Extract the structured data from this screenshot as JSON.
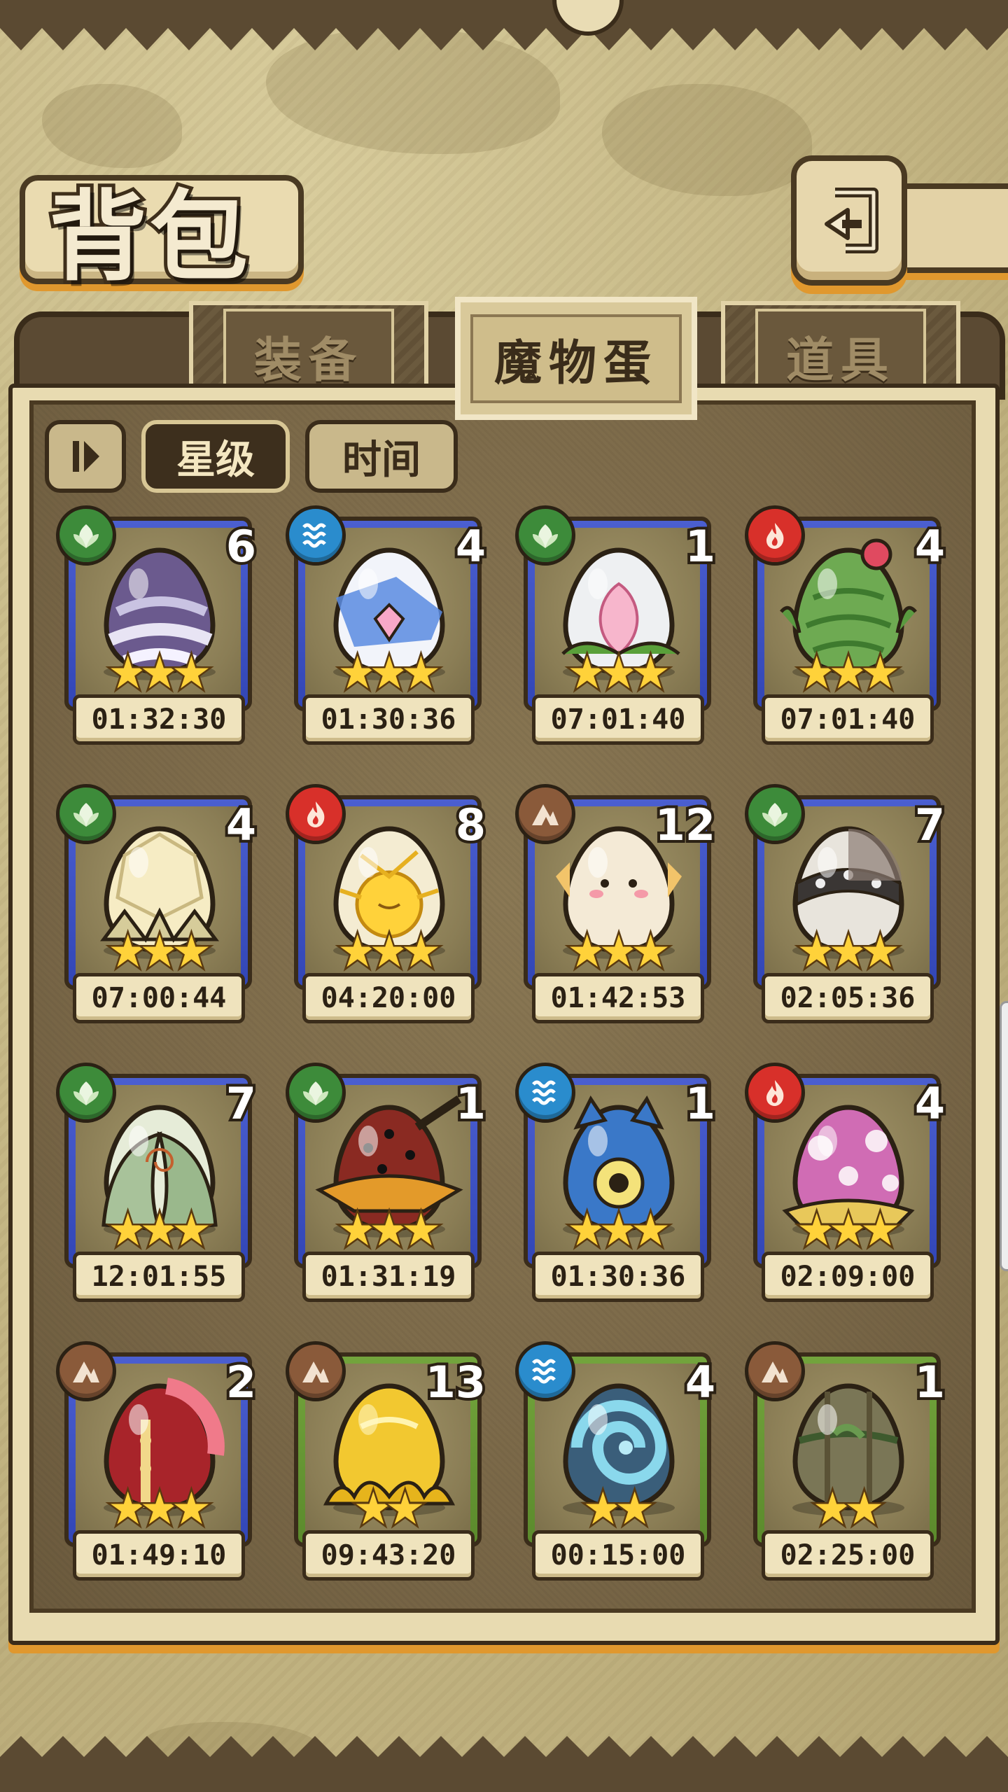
{
  "header": {
    "title": "背包"
  },
  "tabs": [
    {
      "label": "装备",
      "active": false
    },
    {
      "label": "魔物蛋",
      "active": true
    },
    {
      "label": "道具",
      "active": false
    }
  ],
  "toolbar": {
    "sort_star_label": "星级",
    "sort_time_label": "时间"
  },
  "colors": {
    "grass": "#3d8b3a",
    "water": "#2a8ccd",
    "fire": "#d8302a",
    "earth": "#8a5a3a",
    "frame_blue": "#4b5fd0",
    "frame_green": "#73a43c",
    "star": "#ffd23a"
  },
  "eggs": [
    {
      "element": "grass-icon",
      "count": "6",
      "stars": 3,
      "frame": "blue",
      "time": "01:32:30",
      "art": "purple-striped-egg"
    },
    {
      "element": "water-icon",
      "count": "4",
      "stars": 3,
      "frame": "blue",
      "time": "01:30:36",
      "art": "sailor-bow-egg"
    },
    {
      "element": "grass-icon",
      "count": "1",
      "stars": 3,
      "frame": "blue",
      "time": "07:01:40",
      "art": "pink-bud-egg"
    },
    {
      "element": "fire-icon",
      "count": "4",
      "stars": 3,
      "frame": "blue",
      "time": "07:01:40",
      "art": "cactus-egg"
    },
    {
      "element": "grass-icon",
      "count": "4",
      "stars": 3,
      "frame": "blue",
      "time": "07:00:44",
      "art": "lotus-egg"
    },
    {
      "element": "fire-icon",
      "count": "8",
      "stars": 3,
      "frame": "blue",
      "time": "04:20:00",
      "art": "sun-egg"
    },
    {
      "element": "earth-icon",
      "count": "12",
      "stars": 3,
      "frame": "blue",
      "time": "01:42:53",
      "art": "fluffy-egg"
    },
    {
      "element": "grass-icon",
      "count": "7",
      "stars": 3,
      "frame": "blue",
      "time": "02:05:36",
      "art": "spiked-collar-egg"
    },
    {
      "element": "grass-icon",
      "count": "7",
      "stars": 3,
      "frame": "blue",
      "time": "12:01:55",
      "art": "leaf-wrap-egg"
    },
    {
      "element": "grass-icon",
      "count": "1",
      "stars": 3,
      "frame": "blue",
      "time": "01:31:19",
      "art": "feather-hat-egg"
    },
    {
      "element": "water-icon",
      "count": "1",
      "stars": 3,
      "frame": "blue",
      "time": "01:30:36",
      "art": "cyclops-egg"
    },
    {
      "element": "fire-icon",
      "count": "4",
      "stars": 3,
      "frame": "blue",
      "time": "02:09:00",
      "art": "mushroom-egg"
    },
    {
      "element": "earth-icon",
      "count": "2",
      "stars": 3,
      "frame": "blue",
      "time": "01:49:10",
      "art": "helmet-egg"
    },
    {
      "element": "earth-icon",
      "count": "13",
      "stars": 2,
      "frame": "green",
      "time": "09:43:20",
      "art": "gold-slime-egg"
    },
    {
      "element": "water-icon",
      "count": "4",
      "stars": 2,
      "frame": "green",
      "time": "00:15:00",
      "art": "shell-egg"
    },
    {
      "element": "earth-icon",
      "count": "1",
      "stars": 2,
      "frame": "green",
      "time": "02:25:00",
      "art": "vine-egg"
    }
  ]
}
